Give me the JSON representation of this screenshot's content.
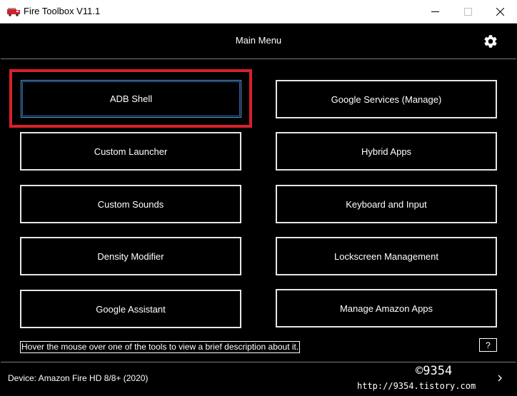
{
  "window": {
    "title": "Fire Toolbox V11.1",
    "icon": "fire-truck-icon"
  },
  "header": {
    "title": "Main Menu",
    "settings_icon": "gear-icon"
  },
  "tools": {
    "left": [
      {
        "label": "ADB Shell"
      },
      {
        "label": "Custom Launcher"
      },
      {
        "label": "Custom Sounds"
      },
      {
        "label": "Density Modifier"
      },
      {
        "label": "Google Assistant"
      }
    ],
    "right": [
      {
        "label": "Google Services (Manage)"
      },
      {
        "label": "Hybrid Apps"
      },
      {
        "label": "Keyboard and Input"
      },
      {
        "label": "Lockscreen Management"
      },
      {
        "label": "Manage Amazon Apps"
      }
    ]
  },
  "footer": {
    "hint": "Hover the mouse over one of the tools to view a brief description about it.",
    "help_label": "?",
    "device": "Device: Amazon Fire HD 8/8+ (2020)"
  },
  "watermark": {
    "mark": "©9354",
    "url": "http://9354.tistory.com"
  },
  "colors": {
    "background": "#000000",
    "button_border": "#e6e6e6",
    "highlight": "#d8202a",
    "focus": "#2f6fb5"
  }
}
